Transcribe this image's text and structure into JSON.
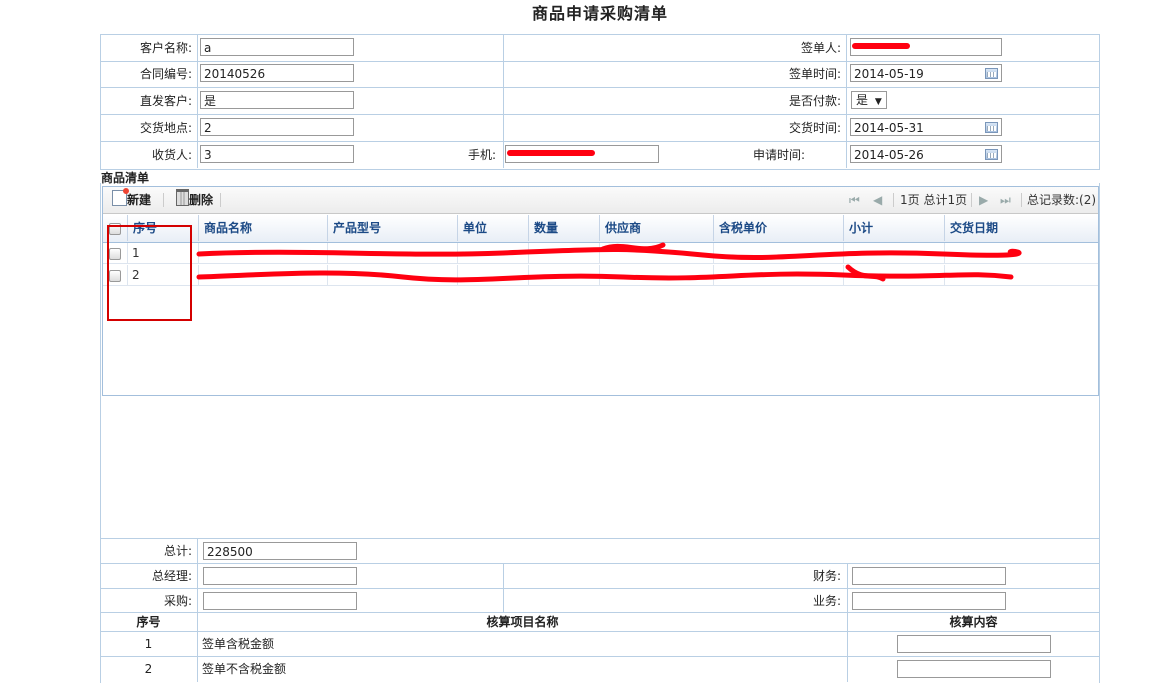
{
  "page": {
    "title": "商品申请采购清单"
  },
  "form": {
    "customer_name": {
      "label": "客户名称:",
      "value": "a"
    },
    "contract_no": {
      "label": "合同编号:",
      "value": "20140526"
    },
    "direct_customer": {
      "label": "直发客户:",
      "value": "是"
    },
    "delivery_place": {
      "label": "交货地点:",
      "value": "2"
    },
    "receiver": {
      "label": "收货人:",
      "value": "3"
    },
    "phone": {
      "label": "手机:",
      "value": ""
    },
    "signer": {
      "label": "签单人:",
      "value": ""
    },
    "sign_time": {
      "label": "签单时间:",
      "value": "2014-05-19"
    },
    "paid": {
      "label": "是否付款:",
      "value": "是"
    },
    "delivery_time": {
      "label": "交货时间:",
      "value": "2014-05-31"
    },
    "apply_time": {
      "label": "申请时间:",
      "value": "2014-05-26"
    }
  },
  "goods": {
    "section_title": "商品清单",
    "toolbar": {
      "new_label": "新建",
      "delete_label": "删除"
    },
    "pager": {
      "page_text": "1页 总计1页",
      "total_text": "总记录数:(2)"
    },
    "columns": [
      "序号",
      "商品名称",
      "产品型号",
      "单位",
      "数量",
      "供应商",
      "含税单价",
      "小计",
      "交货日期"
    ],
    "rows": [
      [
        "1",
        "",
        "",
        "",
        "",
        "",
        "",
        "",
        ""
      ],
      [
        "2",
        "",
        "",
        "",
        "",
        "",
        "",
        "",
        ""
      ]
    ]
  },
  "summary": {
    "total": {
      "label": "总计:",
      "value": "228500"
    },
    "general_manager": {
      "label": "总经理:",
      "value": ""
    },
    "finance": {
      "label": "财务:",
      "value": ""
    },
    "purchase": {
      "label": "采购:",
      "value": ""
    },
    "business": {
      "label": "业务:",
      "value": ""
    }
  },
  "accounting": {
    "headers": [
      "序号",
      "核算项目名称",
      "核算内容"
    ],
    "rows": [
      {
        "no": "1",
        "name": "签单含税金额",
        "content": ""
      },
      {
        "no": "2",
        "name": "签单不含税金额",
        "content": ""
      }
    ]
  },
  "colors": {
    "border": "#b9cfe4",
    "header_text": "#1c4a86",
    "redaction": "#ff0010",
    "annotation": "#d40000"
  }
}
